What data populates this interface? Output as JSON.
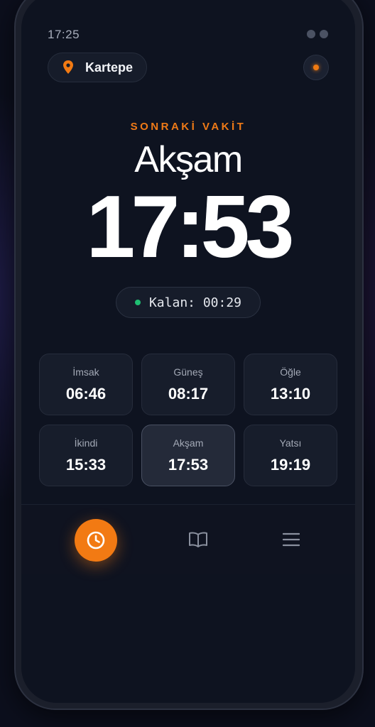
{
  "status_bar": {
    "time": "17:25"
  },
  "header": {
    "location": "Kartepe"
  },
  "next_prayer": {
    "label": "SONRAKİ VAKİT",
    "name": "Akşam",
    "time": "17:53",
    "remaining": "Kalan: 00:29"
  },
  "prayers": [
    {
      "name": "İmsak",
      "time": "06:46"
    },
    {
      "name": "Güneş",
      "time": "08:17"
    },
    {
      "name": "Öğle",
      "time": "13:10"
    },
    {
      "name": "İkindi",
      "time": "15:33"
    },
    {
      "name": "Akşam",
      "time": "17:53"
    },
    {
      "name": "Yatsı",
      "time": "19:19"
    }
  ],
  "active_prayer": "Akşam",
  "nav": {
    "items": [
      {
        "icon": "clock-icon",
        "active": true
      },
      {
        "icon": "book-icon",
        "active": false
      },
      {
        "icon": "menu-icon",
        "active": false
      }
    ]
  },
  "colors": {
    "accent": "#f27a13",
    "remaining_dot": "#1fbf72",
    "background": "#0e1320"
  }
}
